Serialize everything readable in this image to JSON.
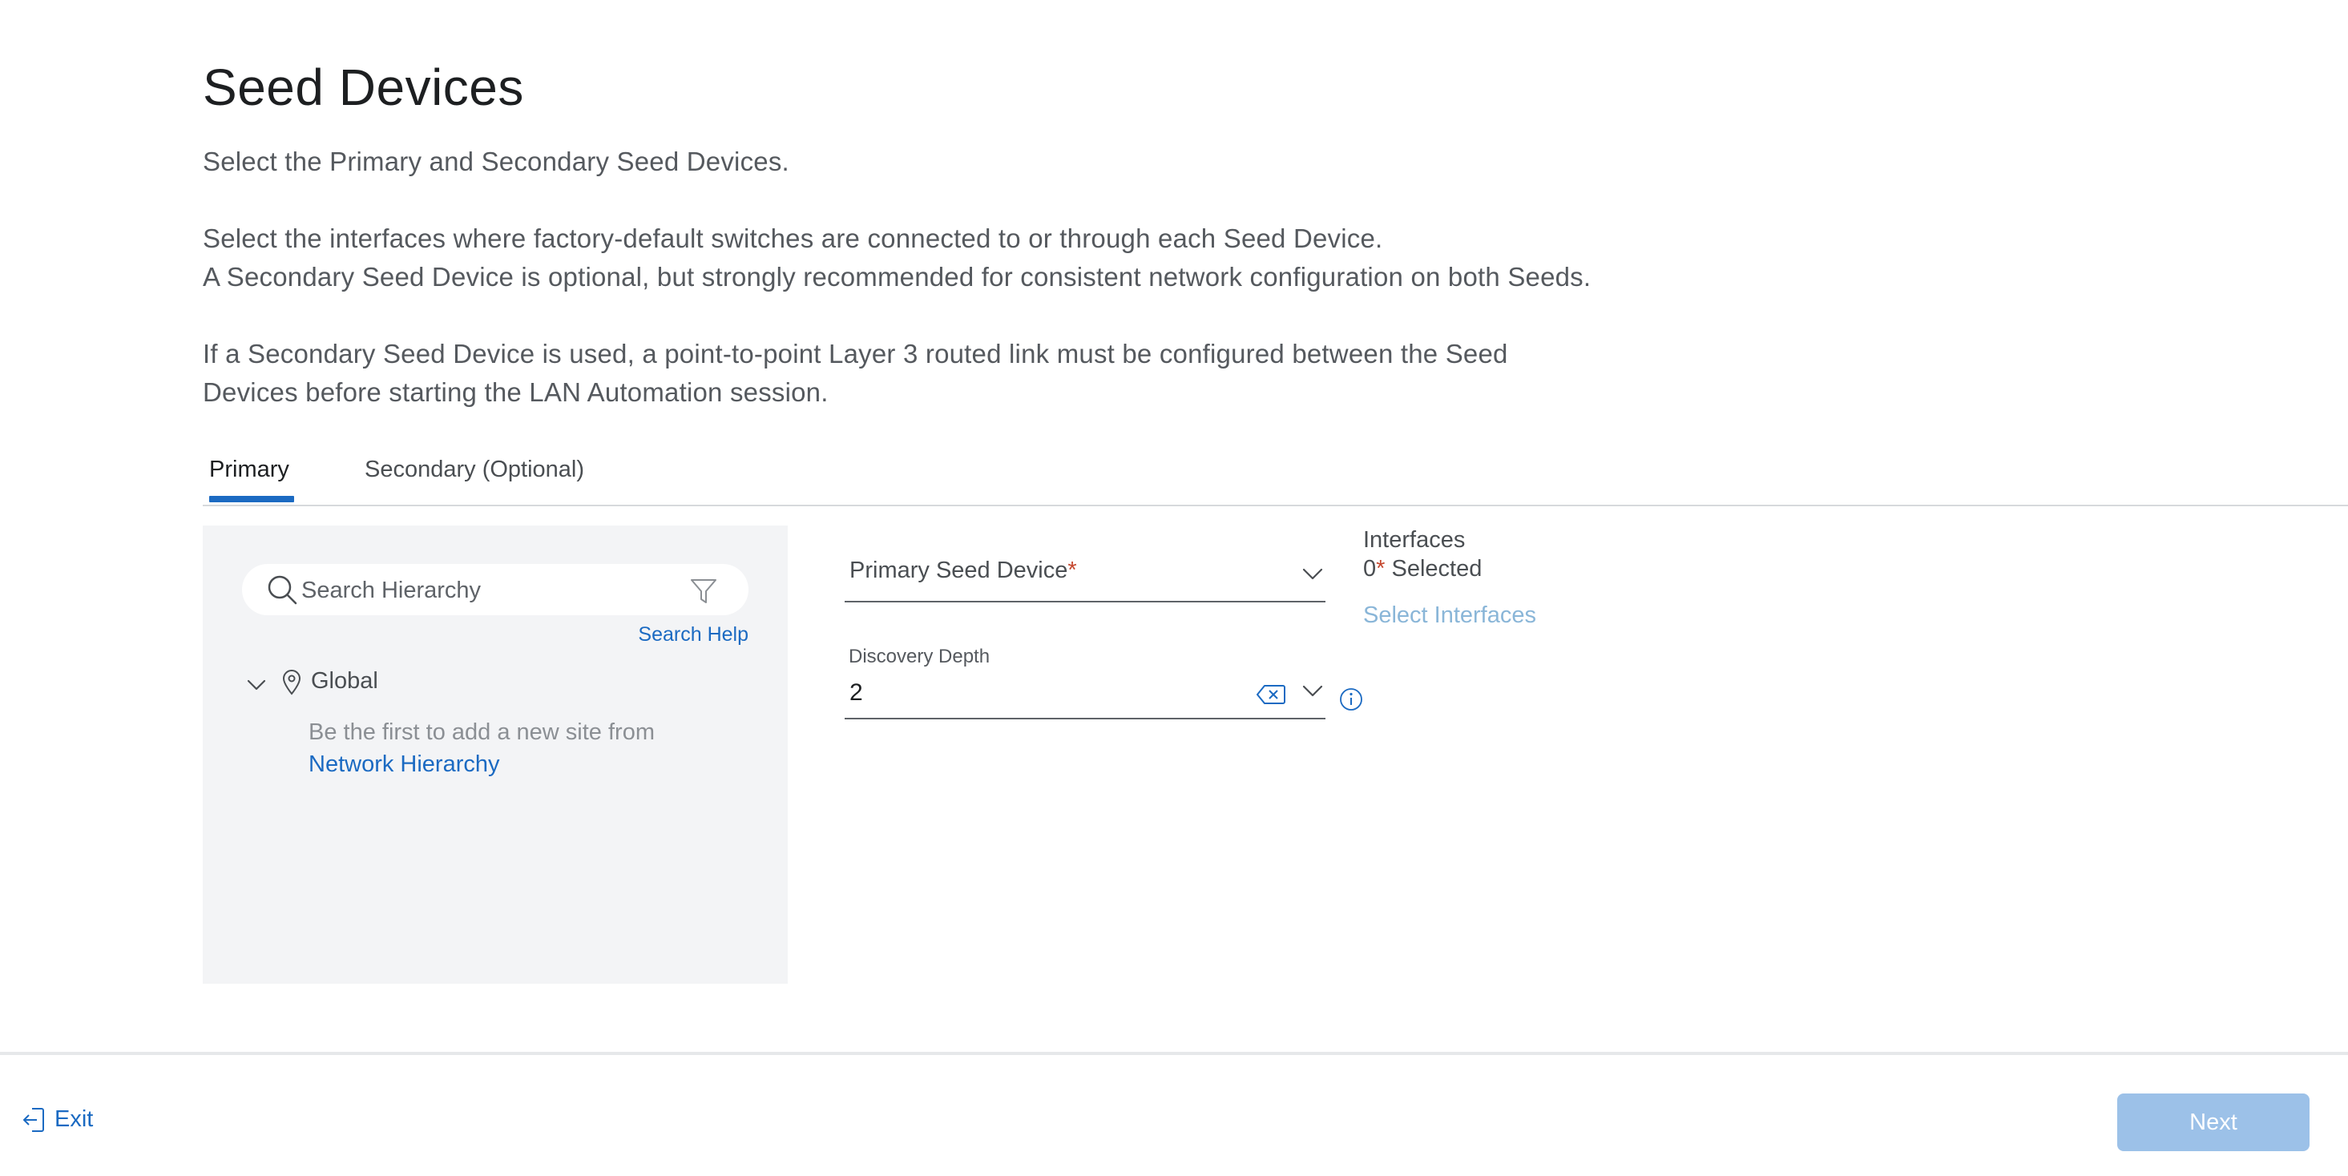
{
  "page": {
    "title": "Seed Devices",
    "intro": "Select the Primary and Secondary Seed Devices.",
    "para2_line1": "Select the interfaces where factory-default switches are connected to or through each Seed Device.",
    "para2_line2": "A Secondary Seed Device is optional, but strongly recommended for consistent network configuration on both Seeds.",
    "para3_line1": "If a Secondary Seed Device is used, a point-to-point Layer 3 routed link must be configured between the Seed",
    "para3_line2": "Devices before starting the LAN Automation session."
  },
  "tabs": [
    {
      "label": "Primary",
      "active": true
    },
    {
      "label": "Secondary (Optional)",
      "active": false
    }
  ],
  "hierarchy": {
    "search_placeholder": "Search Hierarchy",
    "search_help": "Search Help",
    "root_label": "Global",
    "empty_message": "Be the first to add a new site from",
    "empty_link": "Network Hierarchy"
  },
  "form": {
    "primary_seed_label": "Primary Seed Device",
    "required_mark": "*",
    "discovery_depth_label": "Discovery Depth",
    "discovery_depth_value": "2"
  },
  "interfaces": {
    "label": "Interfaces",
    "count": "0",
    "count_suffix": " Selected",
    "select_link": "Select Interfaces"
  },
  "footer": {
    "exit_label": "Exit",
    "next_label": "Next"
  },
  "colors": {
    "accent": "#1b6ac2",
    "required": "#c5472e",
    "disabled_button": "#9cc1e8",
    "panel_bg": "#f3f4f6"
  },
  "icons": [
    "search-icon",
    "filter-icon",
    "chevron-down-icon",
    "location-pin-icon",
    "clear-icon",
    "info-icon",
    "exit-icon"
  ]
}
